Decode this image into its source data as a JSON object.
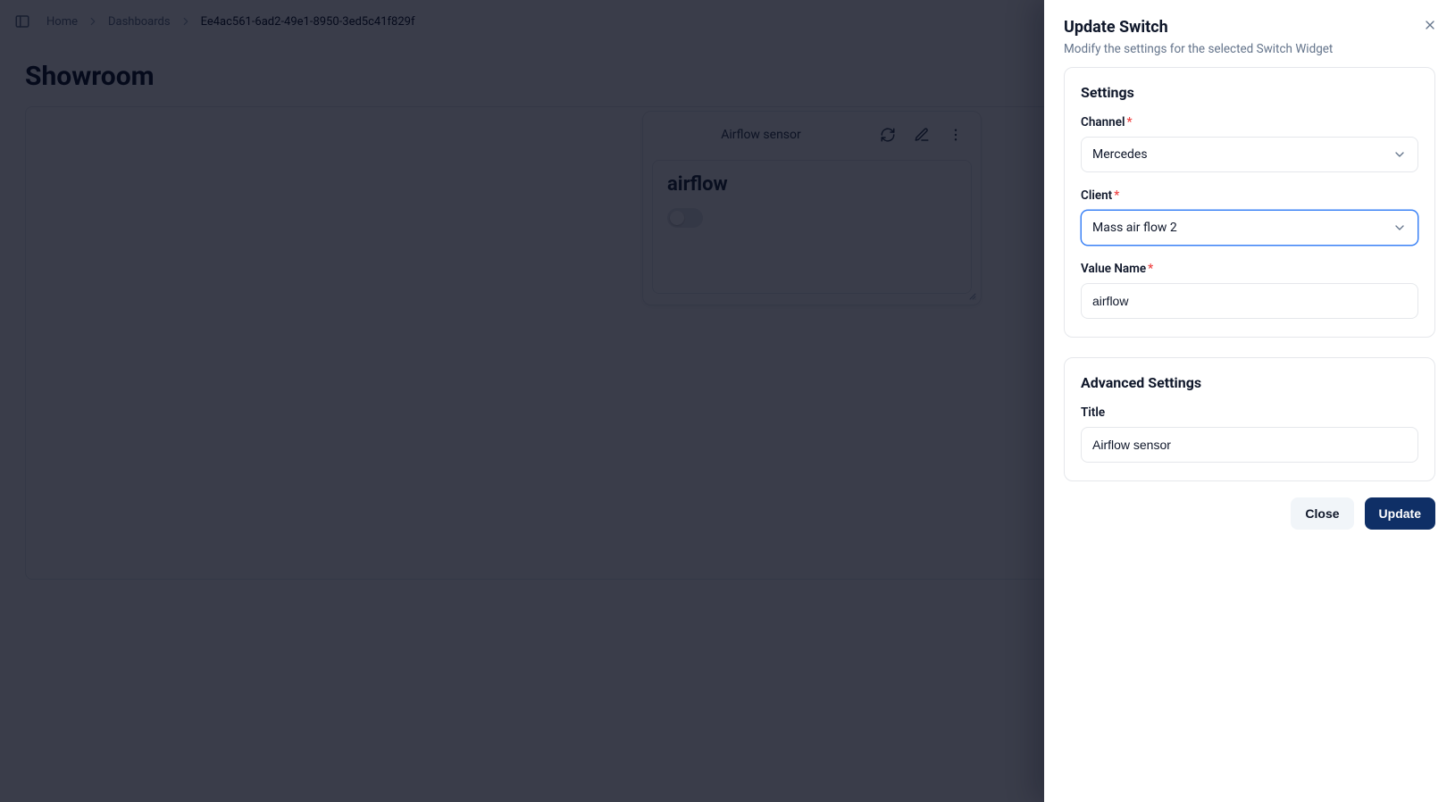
{
  "breadcrumbs": {
    "items": [
      {
        "label": "Home"
      },
      {
        "label": "Dashboards"
      },
      {
        "label": "Ee4ac561-6ad2-49e1-8950-3ed5c41f829f"
      }
    ]
  },
  "page": {
    "title": "Showroom"
  },
  "widget": {
    "title": "Airflow sensor",
    "value_name": "airflow",
    "switch_on": false
  },
  "drawer": {
    "title": "Update Switch",
    "subtitle": "Modify the settings for the selected Switch Widget",
    "sections": {
      "settings": {
        "heading": "Settings",
        "channel": {
          "label": "Channel",
          "required": true,
          "value": "Mercedes"
        },
        "client": {
          "label": "Client",
          "required": true,
          "value": "Mass air flow 2",
          "focused": true
        },
        "value_name": {
          "label": "Value Name",
          "required": true,
          "value": "airflow"
        }
      },
      "advanced": {
        "heading": "Advanced Settings",
        "title": {
          "label": "Title",
          "value": "Airflow sensor"
        }
      }
    },
    "buttons": {
      "close": "Close",
      "update": "Update"
    }
  }
}
